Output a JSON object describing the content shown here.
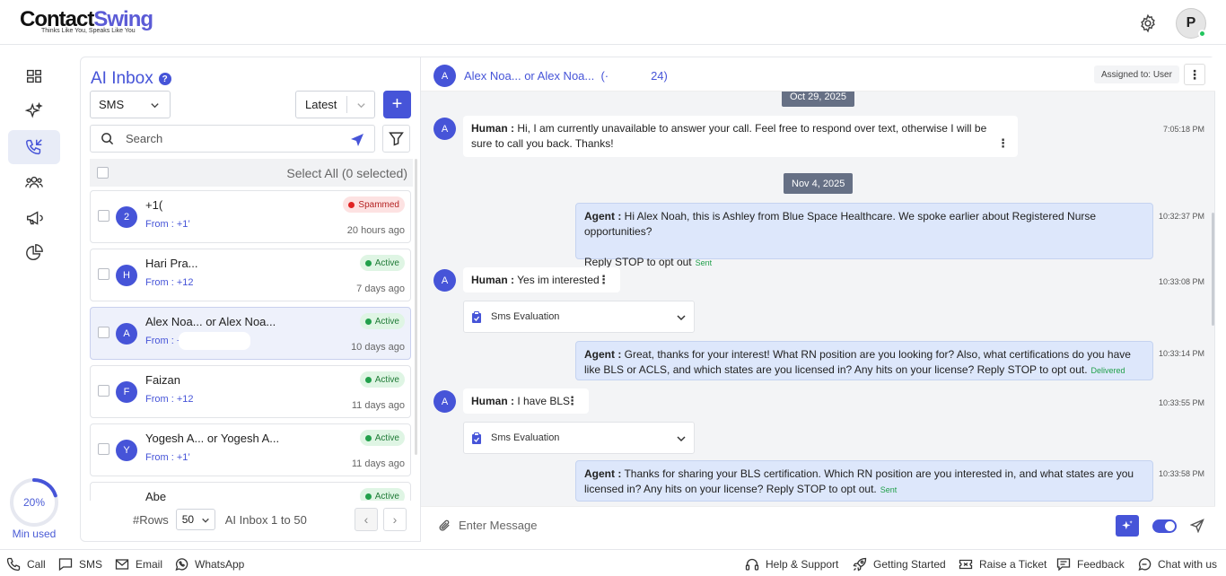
{
  "brand": {
    "name_part1": "Contact",
    "name_part2": "Swing",
    "tagline": "Thinks Like You, Speaks Like You"
  },
  "header": {
    "avatar_initial": "P"
  },
  "usage": {
    "percent_label": "20%",
    "label": "Min used",
    "fraction": 0.2
  },
  "inbox": {
    "title": "AI Inbox",
    "help_icon": "?",
    "channel_select": "SMS",
    "sort_select": "Latest",
    "add_label": "+",
    "search_placeholder": "Search",
    "select_all": "Select All (0 selected)",
    "conversations": [
      {
        "initial": "2",
        "name": "+1(",
        "from": "From : +1’",
        "badge": "Spammed",
        "time": "20 hours ago"
      },
      {
        "initial": "H",
        "name": "Hari Pra...",
        "from": "From : +12",
        "badge": "Active",
        "time": "7 days ago"
      },
      {
        "initial": "A",
        "name": "Alex Noa... or Alex Noa...",
        "from": "From : +1",
        "badge": "Active",
        "time": "10 days ago"
      },
      {
        "initial": "F",
        "name": "Faizan",
        "from": "From : +12",
        "badge": "Active",
        "time": "11 days ago"
      },
      {
        "initial": "Y",
        "name": "Yogesh A... or Yogesh A...",
        "from": "From : +1’",
        "badge": "Active",
        "time": "11 days ago"
      },
      {
        "initial": "",
        "name": "Abe",
        "from": "",
        "badge": "Active",
        "time": ""
      }
    ],
    "pager": {
      "rows_label": "#Rows",
      "rows_value": "50",
      "range": "AI Inbox 1 to 50",
      "prev": "‹",
      "next": "›"
    }
  },
  "chat": {
    "avatar_initial": "A",
    "title": "Alex Noa... or Alex Noa...",
    "title_suffix": "(·             24)",
    "assigned": "Assigned to: User",
    "kebab": "⋮",
    "dates": [
      "Oct 29, 2025",
      "Nov 4, 2025"
    ],
    "messages": [
      {
        "role": "Human :",
        "text": "Hi, I am currently unavailable to answer your call. Feel free to respond over text, otherwise I will be sure to call you back. Thanks!",
        "time": "7:05:18 PM"
      },
      {
        "role": "Agent :",
        "text": "Hi Alex Noah, this is Ashley from Blue Space Healthcare. We spoke earlier about Registered Nurse opportunities?",
        "text2": "Reply STOP to opt out",
        "status": "Sent",
        "time": "10:32:37 PM"
      },
      {
        "role": "Human :",
        "text": "Yes im interested",
        "time": "10:33:08 PM"
      },
      {
        "role": "Agent :",
        "text": "Great, thanks for your interest! What RN position are you looking for? Also, what certifications do you have like BLS or ACLS, and which states are you licensed in? Any hits on your license? Reply STOP to opt out.",
        "status": "Delivered",
        "time": "10:33:14 PM"
      },
      {
        "role": "Human :",
        "text": "I have BLS",
        "time": "10:33:55 PM"
      },
      {
        "role": "Agent :",
        "text": "Thanks for sharing your BLS certification. Which RN position are you interested in, and what states are you licensed in? Any hits on your license? Reply STOP to opt out.",
        "status": "Sent",
        "time": "10:33:58 PM"
      }
    ],
    "evaluation_label": "Sms Evaluation",
    "message_placeholder": "Enter Message"
  },
  "footer": {
    "left": [
      "Call",
      "SMS",
      "Email",
      "WhatsApp"
    ],
    "right": [
      "Help & Support",
      "Getting Started",
      "Raise a Ticket",
      "Feedback",
      "Chat with us"
    ]
  },
  "colors": {
    "accent": "#4654d8",
    "active_badge": "#dff5e4",
    "spam_badge": "#fde2e2",
    "agent_bubble": "#dde7fb"
  }
}
